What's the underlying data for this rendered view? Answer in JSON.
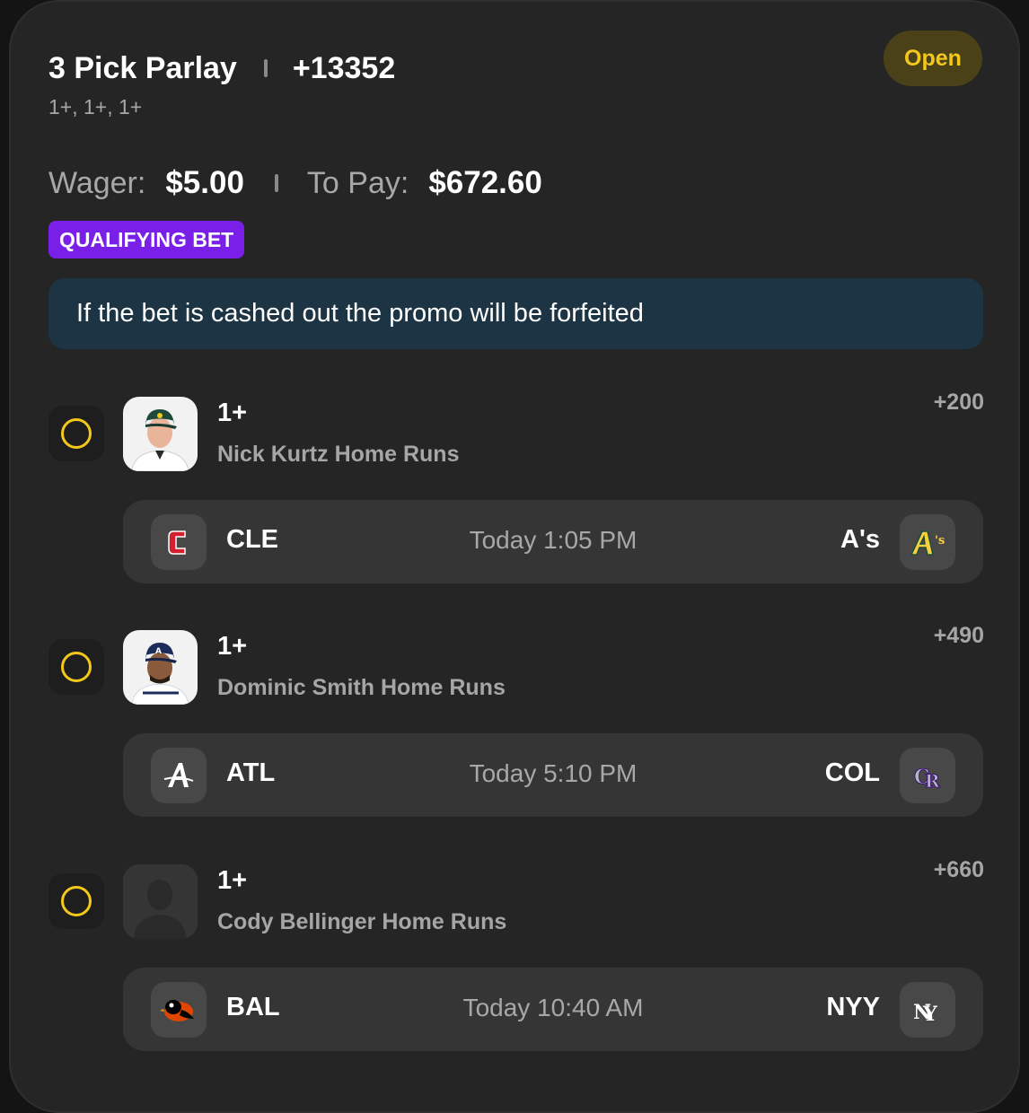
{
  "header": {
    "title": "3 Pick Parlay",
    "total_odds": "+13352",
    "legs_summary": "1+, 1+, 1+",
    "status": "Open"
  },
  "wager": {
    "wager_label": "Wager:",
    "wager_value": "$5.00",
    "payout_label": "To Pay:",
    "payout_value": "$672.60"
  },
  "badge": "QUALIFYING BET",
  "promo_notice": "If the bet is cashed out the promo will be forfeited",
  "legs": [
    {
      "line": "1+",
      "description": "Nick Kurtz Home Runs",
      "odds": "+200",
      "game": {
        "away_abbr": "CLE",
        "away_icon": "guardians-logo-icon",
        "time": "Today 1:05 PM",
        "home_abbr": "A's",
        "home_icon": "athletics-logo-icon"
      }
    },
    {
      "line": "1+",
      "description": "Dominic Smith Home Runs",
      "odds": "+490",
      "game": {
        "away_abbr": "ATL",
        "away_icon": "braves-logo-icon",
        "time": "Today 5:10 PM",
        "home_abbr": "COL",
        "home_icon": "rockies-logo-icon"
      }
    },
    {
      "line": "1+",
      "description": "Cody Bellinger Home Runs",
      "odds": "+660",
      "game": {
        "away_abbr": "BAL",
        "away_icon": "orioles-logo-icon",
        "time": "Today 10:40 AM",
        "home_abbr": "NYY",
        "home_icon": "yankees-logo-icon"
      }
    }
  ],
  "colors": {
    "card_bg": "#252525",
    "status_text": "#f4c81a",
    "status_bg": "#4a4119",
    "badge_bg": "#7a1fe8",
    "promo_bg": "#1c3444",
    "ring": "#f2c81a"
  }
}
